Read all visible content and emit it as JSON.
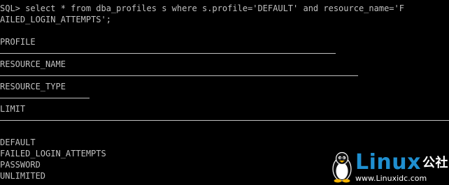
{
  "console": {
    "lines": [
      "SQL> select * from dba_profiles s where s.profile='DEFAULT' and resource_name='F",
      "AILED_LOGIN_ATTEMPTS';",
      "PROFILE",
      "RESOURCE_NAME",
      "RESOURCE_TYPE",
      "LIMIT",
      "DEFAULT",
      "FAILED_LOGIN_ATTEMPTS",
      "PASSWORD",
      "UNLIMITED"
    ]
  },
  "watermark": {
    "brand": "Linux",
    "brand_cn": "公社",
    "url": "www.Linuxidc.com"
  },
  "colors": {
    "background": "#000000",
    "text": "#c0c0c0",
    "brand_blue": "#1f8fd0"
  }
}
